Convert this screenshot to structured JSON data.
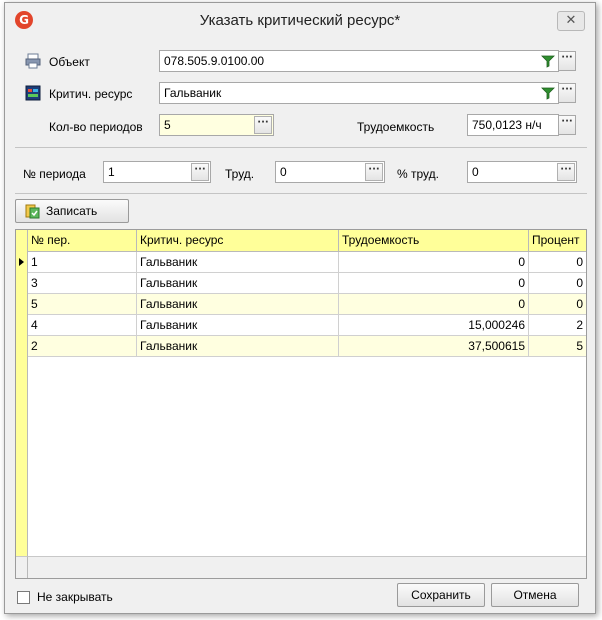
{
  "window": {
    "title": "Указать критический ресурс*",
    "close_symbol": "✕",
    "app_icon_letter": "G"
  },
  "form": {
    "object_label": "Объект",
    "object_value": "078.505.9.0100.00",
    "object_icon": "printer-icon",
    "resource_label": "Критич. ресурс",
    "resource_value": "Гальваник",
    "resource_icon": "resource-icon",
    "periods_label": "Кол-во периодов",
    "periods_value": "5",
    "labor_label": "Трудоемкость",
    "labor_value": "750,0123 н/ч",
    "period_no_label": "№ периода",
    "period_no_value": "1",
    "trud_label": "Труд.",
    "trud_value": "0",
    "pct_label": "% труд.",
    "pct_value": "0",
    "ellipsis": "···"
  },
  "toolbar": {
    "save_record_label": "Записать"
  },
  "table": {
    "columns": [
      "№ пер.",
      "Критич. ресурс",
      "Трудоемкость",
      "Процент"
    ],
    "rows": [
      {
        "period": "1",
        "resource": "Гальваник",
        "labor": "0",
        "percent": "0"
      },
      {
        "period": "3",
        "resource": "Гальваник",
        "labor": "0",
        "percent": "0"
      },
      {
        "period": "5",
        "resource": "Гальваник",
        "labor": "0",
        "percent": "0"
      },
      {
        "period": "4",
        "resource": "Гальваник",
        "labor": "15,000246",
        "percent": "2"
      },
      {
        "period": "2",
        "resource": "Гальваник",
        "labor": "37,500615",
        "percent": "5"
      }
    ]
  },
  "footer": {
    "keep_open_label": "Не закрывать",
    "keep_open_checked": false,
    "save_label": "Сохранить",
    "cancel_label": "Отмена"
  },
  "colors": {
    "grid_header": "#ffff99",
    "row_alt": "#ffffe0",
    "app_icon": "#e2452b"
  }
}
